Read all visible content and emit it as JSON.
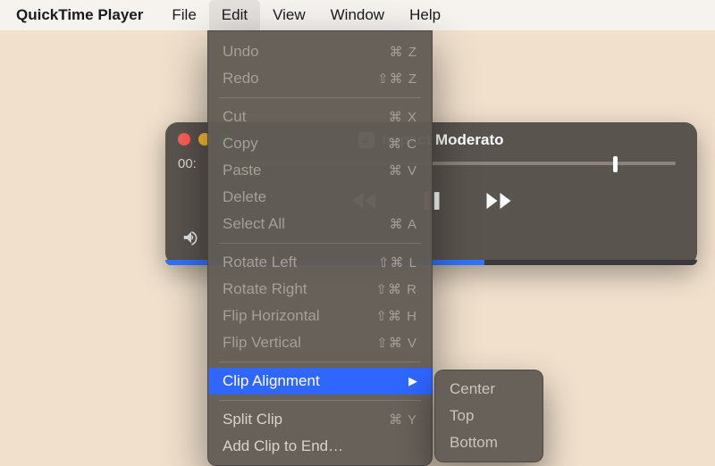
{
  "menubar": {
    "app": "QuickTime Player",
    "items": [
      "File",
      "Edit",
      "View",
      "Window",
      "Help"
    ],
    "open_index": 1
  },
  "player": {
    "title": "Impact Moderato",
    "time_left": "00:",
    "scrub_position_pct": 86,
    "progress_pct": 60
  },
  "edit_menu": {
    "items": [
      {
        "label": "Undo",
        "shortcut": "⌘ Z",
        "disabled": true
      },
      {
        "label": "Redo",
        "shortcut": "⇧⌘ Z",
        "disabled": true
      },
      {
        "sep": true
      },
      {
        "label": "Cut",
        "shortcut": "⌘ X",
        "disabled": true
      },
      {
        "label": "Copy",
        "shortcut": "⌘ C",
        "disabled": true
      },
      {
        "label": "Paste",
        "shortcut": "⌘ V",
        "disabled": true
      },
      {
        "label": "Delete",
        "shortcut": "",
        "disabled": true
      },
      {
        "label": "Select All",
        "shortcut": "⌘ A",
        "disabled": true
      },
      {
        "sep": true
      },
      {
        "label": "Rotate Left",
        "shortcut": "⇧⌘ L",
        "disabled": true
      },
      {
        "label": "Rotate Right",
        "shortcut": "⇧⌘ R",
        "disabled": true
      },
      {
        "label": "Flip Horizontal",
        "shortcut": "⇧⌘ H",
        "disabled": true
      },
      {
        "label": "Flip Vertical",
        "shortcut": "⇧⌘ V",
        "disabled": true
      },
      {
        "sep": true
      },
      {
        "label": "Clip Alignment",
        "shortcut": "",
        "submenu": true,
        "highlight": true
      },
      {
        "sep": true
      },
      {
        "label": "Split Clip",
        "shortcut": "⌘ Y"
      },
      {
        "label": "Add Clip to End…",
        "shortcut": ""
      }
    ]
  },
  "submenu": {
    "items": [
      "Center",
      "Top",
      "Bottom"
    ]
  }
}
